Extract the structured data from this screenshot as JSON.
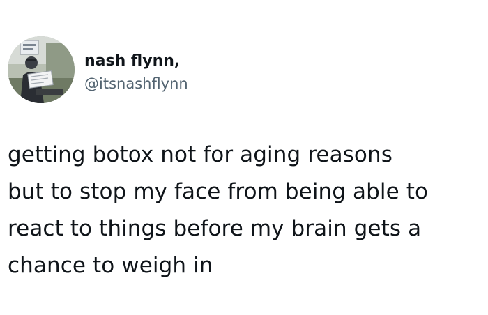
{
  "tweet": {
    "author": {
      "display_name": "nash flynn,",
      "handle": "@itsnashflynn",
      "avatar_icon": "profile-photo"
    },
    "text_lines": [
      "getting botox not for aging reasons",
      "but to stop my face from being able to",
      "react to things before my brain gets a",
      "chance to weigh in"
    ]
  }
}
